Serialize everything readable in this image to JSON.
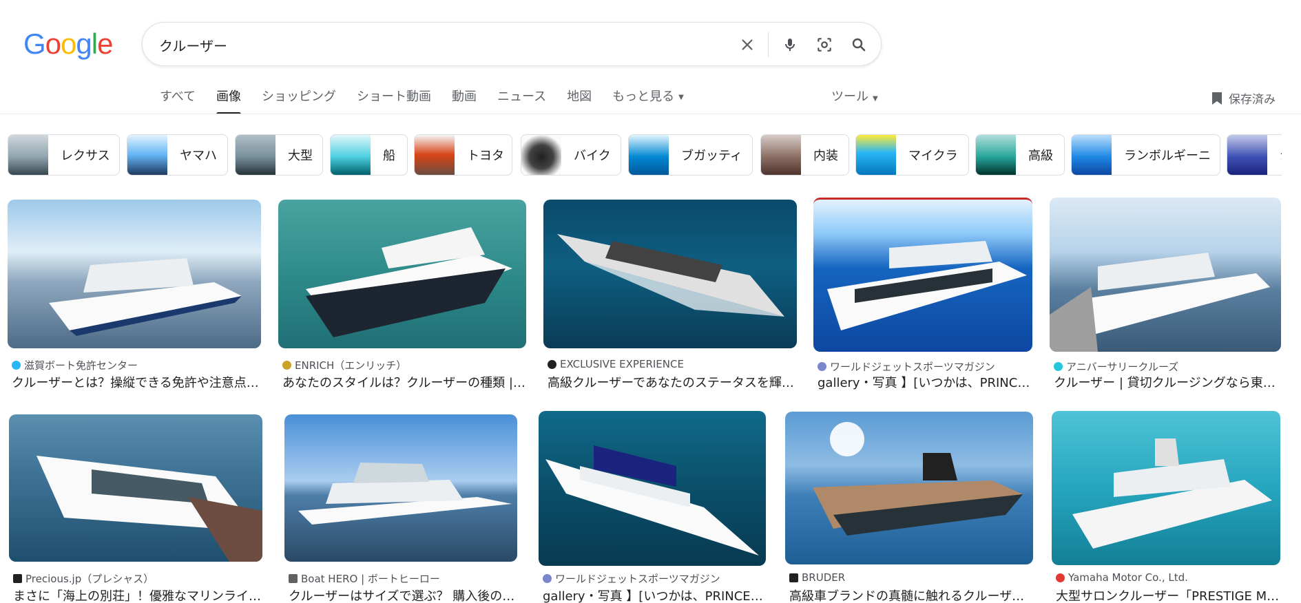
{
  "search": {
    "query": "クルーザー"
  },
  "tabs": [
    {
      "label": "すべて"
    },
    {
      "label": "画像"
    },
    {
      "label": "ショッピング"
    },
    {
      "label": "ショート動画"
    },
    {
      "label": "動画"
    },
    {
      "label": "ニュース"
    },
    {
      "label": "地図"
    },
    {
      "label": "もっと見る"
    }
  ],
  "tools_label": "ツール",
  "saved_label": "保存済み",
  "chips": [
    {
      "label": "レクサス"
    },
    {
      "label": "ヤマハ"
    },
    {
      "label": "大型"
    },
    {
      "label": "船"
    },
    {
      "label": "トヨタ"
    },
    {
      "label": "バイク"
    },
    {
      "label": "ブガッティ"
    },
    {
      "label": "内装"
    },
    {
      "label": "マイクラ"
    },
    {
      "label": "高級"
    },
    {
      "label": "ランボルギーニ"
    },
    {
      "label": "ジ"
    }
  ],
  "results": [
    {
      "source": "滋賀ボート免許センター",
      "title": "クルーザーとは？操縦できる免許や注意点…"
    },
    {
      "source": "ENRICH（エンリッチ）",
      "title": "あなたのスタイルは？クルーザーの種類 |…"
    },
    {
      "source": "EXCLUSIVE EXPERIENCE",
      "title": "高級クルーザーであなたのステータスを輝…"
    },
    {
      "source": "ワールドジェットスポーツマガジン",
      "title": "gallery・写真 】[いつかは、PRINCE…"
    },
    {
      "source": "アニバーサリークルーズ",
      "title": "クルーザー | 貸切クルージングなら東…"
    },
    {
      "source": "Precious.jp（プレシャス）",
      "title": "まさに「海上の別荘」！優雅なマリンライ…"
    },
    {
      "source": "Boat HERO | ボートヒーロー",
      "title": "クルーザーはサイズで選ぶ？ 購入後の…"
    },
    {
      "source": "ワールドジェットスポーツマガジン",
      "title": "gallery・写真 】[いつかは、PRINCES…"
    },
    {
      "source": "BRUDER",
      "title": "高級車ブランドの真髄に触れるクルーザー…"
    },
    {
      "source": "Yamaha Motor Co., Ltd.",
      "title": "大型サロンクルーザー「PRESTIGE M…"
    }
  ]
}
